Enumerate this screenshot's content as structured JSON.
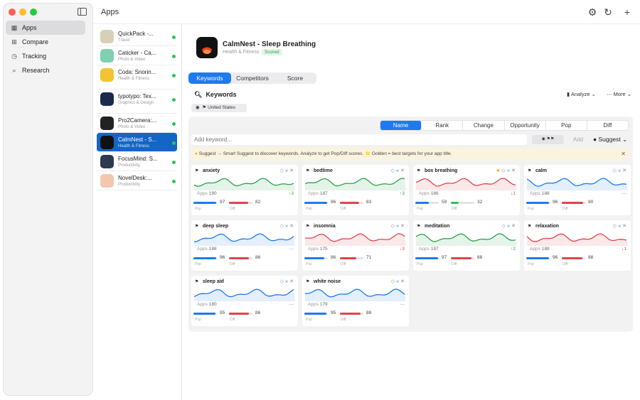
{
  "window": {
    "title": "Apps"
  },
  "nav": [
    {
      "label": "Apps",
      "icon": "grid-icon",
      "active": true
    },
    {
      "label": "Compare",
      "icon": "compare-icon",
      "active": false
    },
    {
      "label": "Tracking",
      "icon": "clock-icon",
      "active": false
    },
    {
      "label": "Research",
      "icon": "search-icon",
      "active": false
    }
  ],
  "apps": [
    {
      "name": "QuickPack -...",
      "category": "Travel",
      "color": "#d8cfb8",
      "active": false
    },
    {
      "name": "Caticker - Ca...",
      "category": "Photo & Video",
      "color": "#7fd0b0",
      "active": false
    },
    {
      "name": "Coda: Snorin...",
      "category": "Health & Fitness",
      "color": "#f3c431",
      "active": false
    },
    {
      "name": "typotypo: Tex...",
      "category": "Graphics & Design",
      "color": "#1b2a4a",
      "active": false
    },
    {
      "name": "Pro2Camera:...",
      "category": "Photo & Video",
      "color": "#222222",
      "active": false
    },
    {
      "name": "CalmNest - S...",
      "category": "Health & Fitness",
      "color": "#111111",
      "active": true
    },
    {
      "name": "FocusMind: S...",
      "category": "Productivity",
      "color": "#2d3a50",
      "active": false
    },
    {
      "name": "NovelDesk:...",
      "category": "Productivity",
      "color": "#f1c7ad",
      "active": false
    }
  ],
  "selected_app": {
    "name": "CalmNest - Sleep Breathing",
    "category": "Health & Fitness",
    "badge": "Scored"
  },
  "tabs": [
    {
      "label": "Keywords",
      "active": true
    },
    {
      "label": "Competitors",
      "active": false
    },
    {
      "label": "Score",
      "active": false
    }
  ],
  "keywords_panel": {
    "title": "Keywords",
    "analyze_label": "Analyze",
    "more_label": "More",
    "country": "United States",
    "sort_options": [
      {
        "label": "Name",
        "active": true
      },
      {
        "label": "Rank",
        "active": false
      },
      {
        "label": "Change",
        "active": false
      },
      {
        "label": "Opportunity",
        "active": false
      },
      {
        "label": "Pop",
        "active": false
      },
      {
        "label": "Diff",
        "active": false
      }
    ],
    "add_placeholder": "Add keyword...",
    "add_button": "Add",
    "suggest_button": "Suggest",
    "tip": "Suggest → Smart Suggest to discover keywords. Analyze to get Pop/Diff scores. ⭐ Golden = best targets for your app title.",
    "apps_label": "Apps",
    "pop_label": "Pop",
    "diff_label": "Diff"
  },
  "keywords": [
    {
      "keyword": "anxiety",
      "apps": 190,
      "change": "↑3",
      "trend": "up",
      "pop": 97,
      "diff": 82,
      "star": false,
      "color": "#2ca14a"
    },
    {
      "keyword": "bedtime",
      "apps": 187,
      "change": "↑3",
      "trend": "up",
      "pop": 96,
      "diff": 83,
      "star": false,
      "color": "#2ca14a"
    },
    {
      "keyword": "box breathing",
      "apps": 186,
      "change": "↓1",
      "trend": "down",
      "pop": 59,
      "diff": 32,
      "star": true,
      "color": "#e0444b"
    },
    {
      "keyword": "calm",
      "apps": 188,
      "change": "—",
      "trend": "flat",
      "pop": 96,
      "diff": 90,
      "star": false,
      "color": "#1d7af0"
    },
    {
      "keyword": "deep sleep",
      "apps": 188,
      "change": "—",
      "trend": "flat",
      "pop": 96,
      "diff": 86,
      "star": false,
      "color": "#1d7af0"
    },
    {
      "keyword": "insomnia",
      "apps": 175,
      "change": "↓3",
      "trend": "down",
      "pop": 86,
      "diff": 71,
      "star": false,
      "color": "#e0444b"
    },
    {
      "keyword": "meditation",
      "apps": 187,
      "change": "↑2",
      "trend": "up",
      "pop": 97,
      "diff": 88,
      "star": false,
      "color": "#2ca14a"
    },
    {
      "keyword": "relaxation",
      "apps": 188,
      "change": "↓1",
      "trend": "down",
      "pop": 96,
      "diff": 88,
      "star": false,
      "color": "#e0444b"
    },
    {
      "keyword": "sleep aid",
      "apps": 180,
      "change": "—",
      "trend": "flat",
      "pop": 95,
      "diff": 86,
      "star": false,
      "color": "#1d7af0"
    },
    {
      "keyword": "white noise",
      "apps": 179,
      "change": "—",
      "trend": "flat",
      "pop": 95,
      "diff": 88,
      "star": false,
      "color": "#1d7af0"
    }
  ]
}
